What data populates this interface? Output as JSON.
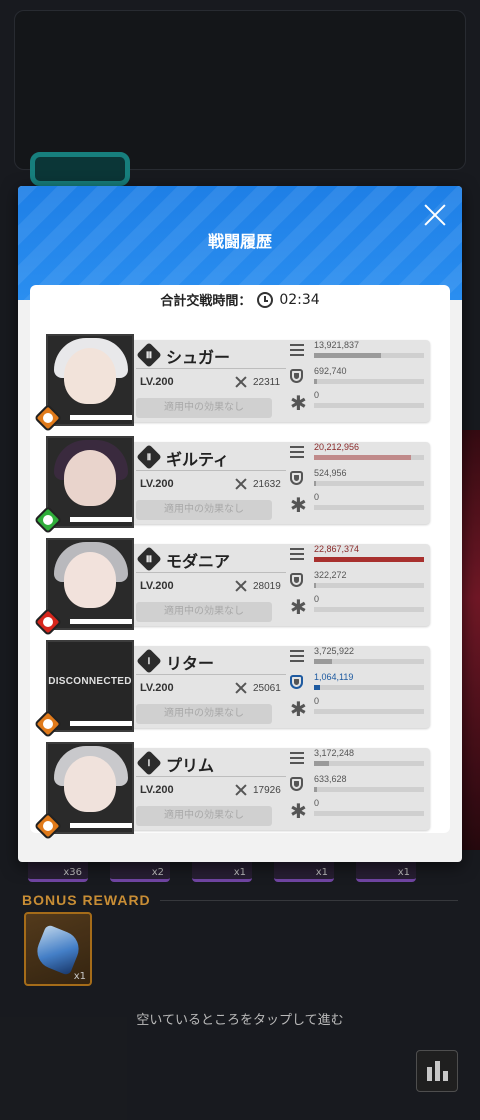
{
  "modal": {
    "title": "戦闘履歴",
    "total_time_label": "合計交戦時間：",
    "total_time_value": "02:34"
  },
  "characters": [
    {
      "name": "シュガー",
      "burst": "Ⅲ",
      "level": "LV.200",
      "power": "22311",
      "effect": "適用中の効果なし",
      "element_color": "#e07a1a",
      "portrait": {
        "hair": "#e8e8ea",
        "face": "#f2e3da",
        "bg": "#2a2a2a"
      },
      "damage": "13,921,837",
      "damage_ratio": 0.61,
      "damage_color": "#9a9a9a",
      "shield": "692,740",
      "shield_ratio": 0.03,
      "shield_color": "#9a9a9a",
      "heal": "0",
      "heal_ratio": 0
    },
    {
      "name": "ギルティ",
      "burst": "Ⅱ",
      "level": "LV.200",
      "power": "21632",
      "effect": "適用中の効果なし",
      "element_color": "#2fae3a",
      "portrait": {
        "hair": "#3a2a3e",
        "face": "#e9d4cc",
        "bg": "#2a2a2a"
      },
      "damage": "20,212,956",
      "damage_ratio": 0.88,
      "damage_color": "#c08a8a",
      "shield": "524,956",
      "shield_ratio": 0.02,
      "shield_color": "#9a9a9a",
      "heal": "0",
      "heal_ratio": 0
    },
    {
      "name": "モダニア",
      "burst": "Ⅲ",
      "level": "LV.200",
      "power": "28019",
      "effect": "適用中の効果なし",
      "element_color": "#d6261c",
      "portrait": {
        "hair": "#b9b9bd",
        "face": "#f2e2dc",
        "bg": "#2a2a2a"
      },
      "damage": "22,867,374",
      "damage_ratio": 1.0,
      "damage_color": "#a8302e",
      "shield": "322,272",
      "shield_ratio": 0.01,
      "shield_color": "#9a9a9a",
      "heal": "0",
      "heal_ratio": 0
    },
    {
      "name": "リター",
      "burst": "Ⅰ",
      "level": "LV.200",
      "power": "25061",
      "effect": "適用中の効果なし",
      "element_color": "#e07a1a",
      "portrait": {
        "hair": "#2a2a2a",
        "face": "#2a2a2a",
        "bg": "#262626"
      },
      "disconnected": "DISCONNECTED",
      "damage": "3,725,922",
      "damage_ratio": 0.16,
      "damage_color": "#9a9a9a",
      "shield": "1,064,119",
      "shield_ratio": 0.05,
      "shield_color": "#1e5aa0",
      "heal": "0",
      "heal_ratio": 0
    },
    {
      "name": "プリム",
      "burst": "Ⅰ",
      "level": "LV.200",
      "power": "17926",
      "effect": "適用中の効果なし",
      "element_color": "#e07a1a",
      "portrait": {
        "hair": "#c9c9cc",
        "face": "#f0e2dc",
        "bg": "#2a2a2a"
      },
      "damage": "3,172,248",
      "damage_ratio": 0.14,
      "damage_color": "#9a9a9a",
      "shield": "633,628",
      "shield_ratio": 0.03,
      "shield_color": "#9a9a9a",
      "heal": "0",
      "heal_ratio": 0
    }
  ],
  "background": {
    "item_counts": [
      "x36",
      "x2",
      "x1",
      "x1",
      "x1"
    ],
    "bonus_title": "BONUS REWARD",
    "bonus_item_qty": "x1",
    "hint": "空いているところをタップして進む"
  },
  "icons": {
    "close": "close-icon",
    "clock": "clock-icon",
    "damage": "damage-icon",
    "shield": "shield-icon",
    "heal": "heal-icon",
    "stats": "bar-chart-icon"
  }
}
